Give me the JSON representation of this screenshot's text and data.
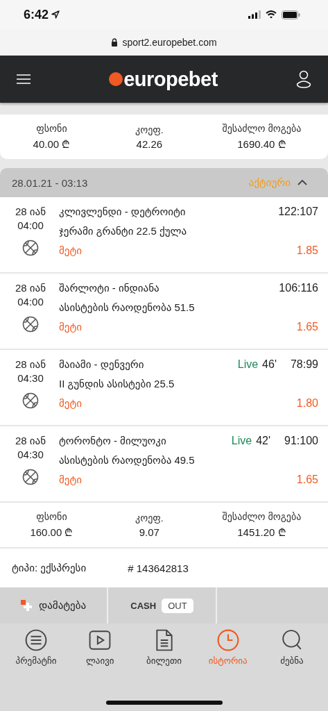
{
  "status_bar": {
    "time": "6:42"
  },
  "url_bar": {
    "url": "sport2.europebet.com"
  },
  "header": {
    "logo": "europebet"
  },
  "top_summary": [
    {
      "label": "ფსონი",
      "value": "40.00 ₾"
    },
    {
      "label": "კოეფ.",
      "value": "42.26"
    },
    {
      "label": "შესაძლო მოგება",
      "value": "1690.40 ₾"
    }
  ],
  "bet": {
    "date": "28.01.21 - 03:13",
    "status": "აქტიური",
    "expanded": true,
    "events": [
      {
        "date": "28 იან",
        "time": "04:00",
        "match": "კლივლენდი - დეტროიტი",
        "market": "ჯერამი გრანტი 22.5 ქულა",
        "pick": "მეტი",
        "score": "122:107",
        "odds": "1.85"
      },
      {
        "date": "28 იან",
        "time": "04:00",
        "match": "შარლოტი - ინდიანა",
        "market": "ასისტების რაოდენობა 51.5",
        "pick": "მეტი",
        "score": "106:116",
        "odds": "1.65"
      },
      {
        "date": "28 იან",
        "time": "04:30",
        "match": "მაიამი - დენვერი",
        "live": "Live",
        "minute": "46'",
        "market": "II გუნდის ასისტები 25.5",
        "pick": "მეტი",
        "score": "78:99",
        "odds": "1.80"
      },
      {
        "date": "28 იან",
        "time": "04:30",
        "match": "ტორონტო - მილუოკი",
        "live": "Live",
        "minute": "42'",
        "market": "ასისტების რაოდენობა 49.5",
        "pick": "მეტი",
        "score": "91:100",
        "odds": "1.65"
      }
    ],
    "summary": [
      {
        "label": "ფსონი",
        "value": "160.00 ₾"
      },
      {
        "label": "კოეფ.",
        "value": "9.07"
      },
      {
        "label": "შესაძლო მოგება",
        "value": "1451.20 ₾"
      }
    ],
    "type": "ტიპი: ექსპრესი",
    "ticket": "# 143642813"
  },
  "actions": [
    {
      "kind": "add",
      "label": "დამატება"
    },
    {
      "kind": "cashout",
      "label": "CASH",
      "badge": "OUT"
    }
  ],
  "tabs": [
    {
      "label": "პრემატჩი",
      "kind": "list",
      "selected": false
    },
    {
      "label": "ლაივი",
      "kind": "play",
      "selected": false
    },
    {
      "label": "ბილეთი",
      "kind": "doc",
      "selected": false
    },
    {
      "label": "ისტორია",
      "kind": "clock",
      "selected": true
    },
    {
      "label": "ძებნა",
      "kind": "search",
      "selected": false
    }
  ]
}
